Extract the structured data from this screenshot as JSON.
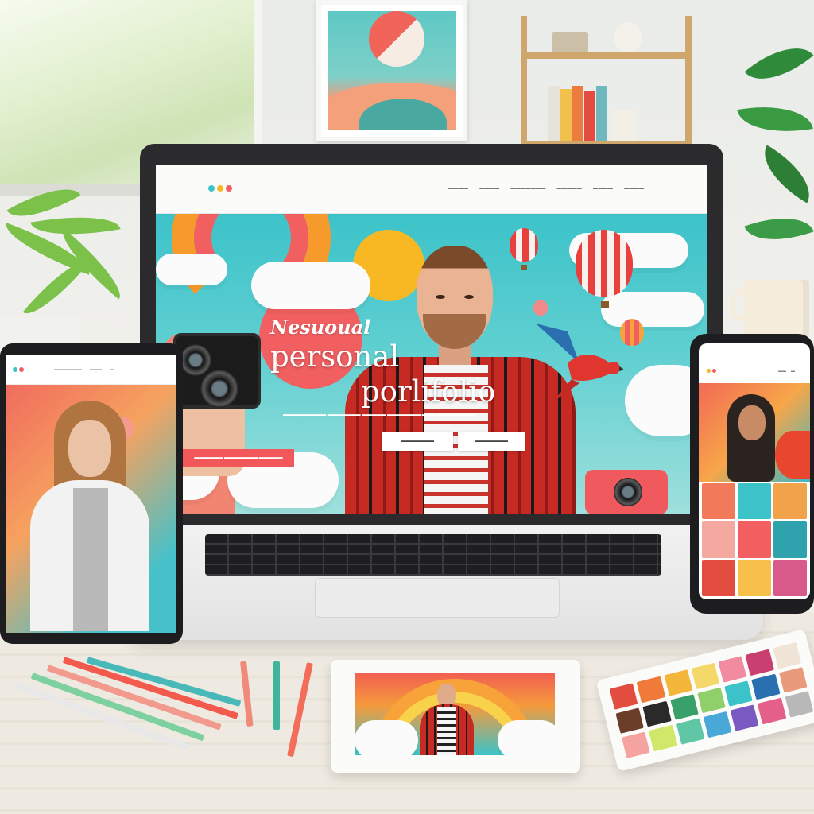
{
  "laptop": {
    "nav": {
      "links": [
        "▬▬▬▬",
        "▬▬▬▬",
        "▬▬▬▬▬▬▬",
        "▬▬▬▬▬",
        "▬▬▬▬",
        "▬▬▬▬"
      ]
    },
    "hero": {
      "eyebrow": "Nesuoual",
      "title_line1": "personal",
      "title_line2": "porlifolio",
      "tagline": "▬▬▬▬▬▬▬▬▬ ▬▬▬▬▬▬▬ ▬▬▬▬▬ ▬▬▬▬▬▬▬ ▬▬▬ ▬▬▬▬▬▬▬▬",
      "button_left": "▬▬▬▬▬▬▬",
      "button_right": "▬▬▬▬▬▬▬",
      "cta_left": "▬▬▬▬▬▬ ▬▬▬▬▬▬▬ ▬▬▬▬▬"
    }
  },
  "tablet": {
    "nav_links": [
      "▬▬▬▬▬▬▬",
      "▬▬▬",
      "▬"
    ]
  },
  "phone": {
    "nav_links": [
      "▬▬",
      "▬"
    ]
  },
  "colors": {
    "accent_red": "#f15f61",
    "teal": "#3cc3c9",
    "sun_yellow": "#f8b824"
  }
}
